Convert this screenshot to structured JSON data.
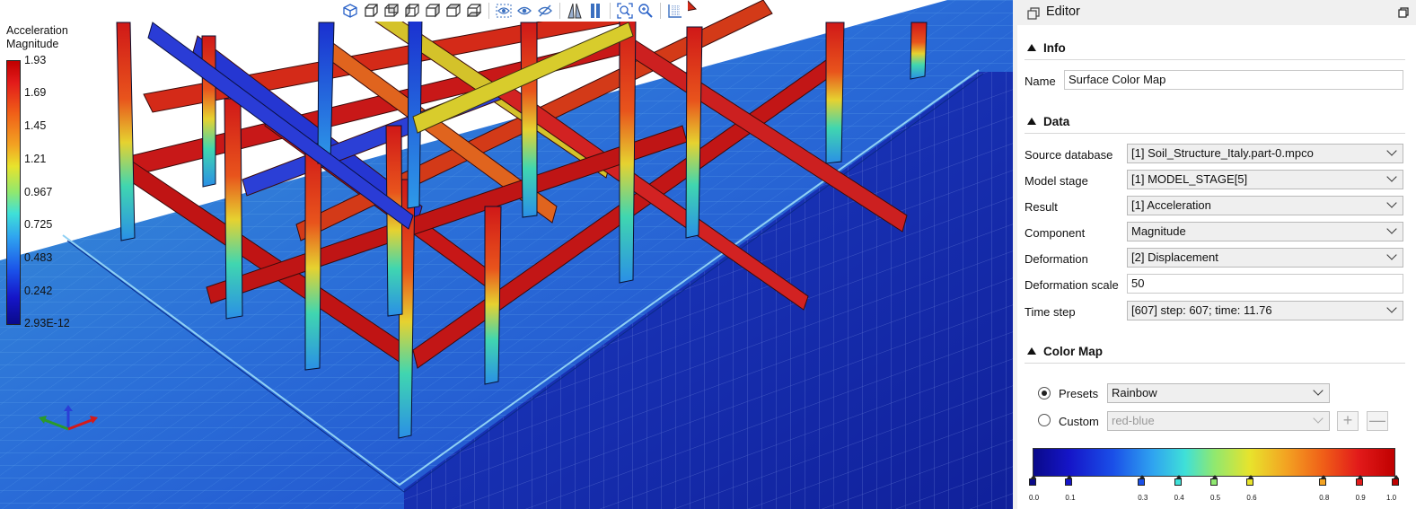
{
  "legend": {
    "title_line1": "Acceleration",
    "title_line2": "Magnitude",
    "labels": [
      "1.93",
      "1.69",
      "1.45",
      "1.21",
      "0.967",
      "0.725",
      "0.483",
      "0.242",
      "2.93E-12"
    ]
  },
  "toolbar": {
    "icons": [
      "iso-view-icon",
      "front-view-icon",
      "back-view-icon",
      "left-view-icon",
      "right-view-icon",
      "top-view-icon",
      "bottom-view-icon",
      "hide-icon",
      "show-icon",
      "hide-all-icon",
      "perspective-icon",
      "parallel-icon",
      "zoom-fit-icon",
      "zoom-icon",
      "grid-icon"
    ]
  },
  "editor": {
    "title": "Editor",
    "info": {
      "header": "Info",
      "name_label": "Name",
      "name_value": "Surface Color Map"
    },
    "data": {
      "header": "Data",
      "source_label": "Source database",
      "source_value": "[1] Soil_Structure_Italy.part-0.mpco",
      "stage_label": "Model stage",
      "stage_value": "[1] MODEL_STAGE[5]",
      "result_label": "Result",
      "result_value": "[1] Acceleration",
      "component_label": "Component",
      "component_value": "Magnitude",
      "deformation_label": "Deformation",
      "deformation_value": "[2] Displacement",
      "scale_label": "Deformation scale",
      "scale_value": "50",
      "timestep_label": "Time step",
      "timestep_value": "[607] step: 607; time: 11.76"
    },
    "colormap": {
      "header": "Color Map",
      "presets_label": "Presets",
      "presets_value": "Rainbow",
      "custom_label": "Custom",
      "custom_value": "red-blue",
      "add_symbol": "+",
      "remove_symbol": "—",
      "ticks": [
        "0.0",
        "0.1",
        "0.3",
        "0.4",
        "0.5",
        "0.6",
        "0.8",
        "0.9",
        "1.0"
      ],
      "stop_colors": [
        "#0a0a8a",
        "#1515c8",
        "#1a4fe8",
        "#3fe0d8",
        "#8fe870",
        "#e8e32c",
        "#f3a322",
        "#e21a1a",
        "#c00000"
      ]
    }
  }
}
